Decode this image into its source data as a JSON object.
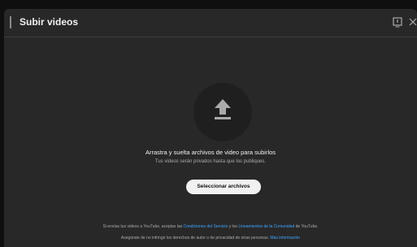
{
  "dialog": {
    "title": "Subir videos",
    "feedback_icon": "feedback-flag-icon",
    "close_icon": "close-icon"
  },
  "upload": {
    "icon": "upload-arrow-icon",
    "headline": "Arrastra y suelta archivos de video para subirlos",
    "subline": "Tus videos serán privados hasta que los publiques.",
    "button_label": "Seleccionar archivos"
  },
  "footer": {
    "line1_prefix": "Si envías tus videos a YouTube, aceptas las ",
    "terms_link": "Condiciones del Servicio",
    "line1_middle": " y los ",
    "guidelines_link": "Lineamientos de la Comunidad",
    "line1_suffix": " de YouTube.",
    "line2_prefix": "Asegúrate de no infringir los derechos de autor o de privacidad de otras personas. ",
    "more_info_link": "Más información"
  },
  "colors": {
    "background": "#0f0f0f",
    "dialog": "#282828",
    "link": "#3ea6ff",
    "button": "#f1f1f1"
  }
}
